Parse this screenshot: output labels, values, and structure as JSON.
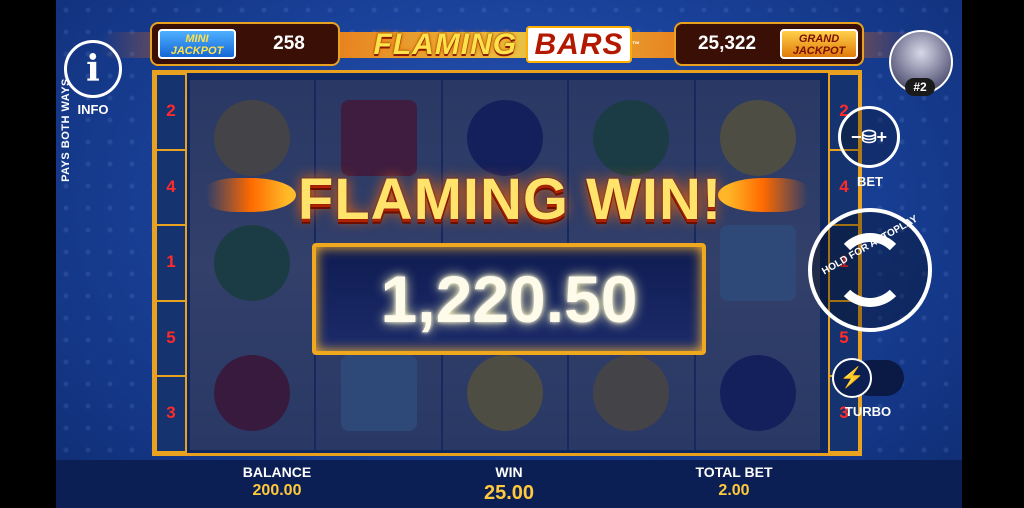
{
  "header": {
    "mini_jackpot_label": "MINI JACKPOT",
    "mini_jackpot_value": "258",
    "logo_word1": "FLAMING",
    "logo_word2": "BARS",
    "logo_tm": "™",
    "grand_jackpot_label": "GRAND JACKPOT",
    "grand_jackpot_value": "25,322"
  },
  "info": {
    "label": "INFO",
    "icon": "i"
  },
  "avatar": {
    "badge": "#2"
  },
  "paylines": {
    "side_text": "PAYS BOTH WAYS",
    "left": [
      "2",
      "4",
      "1",
      "5",
      "3"
    ],
    "right": [
      "2",
      "4",
      "1",
      "5",
      "3"
    ]
  },
  "win": {
    "title": "FLAMING WIN!",
    "amount": "1,220.50"
  },
  "controls": {
    "bet_label": "BET",
    "bet_icon": "−⛁+",
    "spin_hint": "HOLD FOR AUTOPLAY",
    "turbo_label": "TURBO",
    "turbo_icon": "⚡"
  },
  "footer": {
    "balance_label": "BALANCE",
    "balance_value": "200.00",
    "win_label": "WIN",
    "win_value": "25.00",
    "total_bet_label": "TOTAL BET",
    "total_bet_value": "2.00"
  },
  "colors": {
    "accent_gold": "#e8a21f",
    "value_gold": "#ffc93c",
    "payline_red": "#ff2a2a",
    "background_blue": "#183f95"
  }
}
